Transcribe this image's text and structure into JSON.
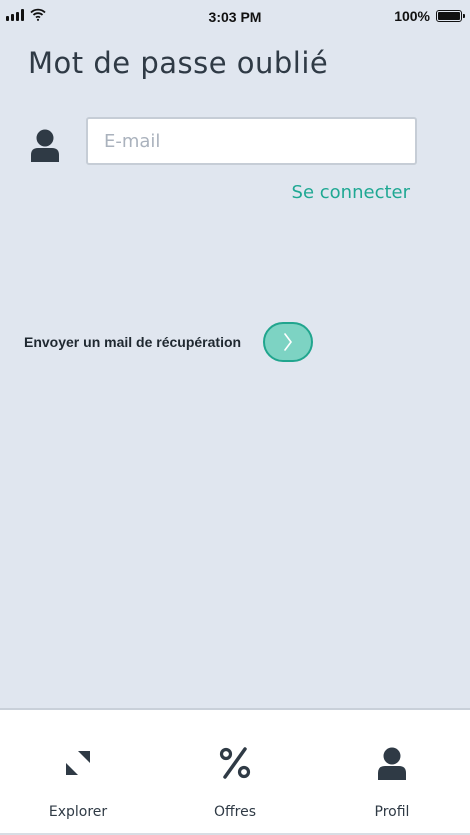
{
  "status_bar": {
    "time": "3:03 PM",
    "battery": "100%"
  },
  "page": {
    "title": "Mot de passe oublié"
  },
  "form": {
    "email_placeholder": "E-mail",
    "email_value": "",
    "signin_link": "Se connecter",
    "send_label": "Envoyer un mail de récupération"
  },
  "tabs": [
    {
      "label": "Explorer",
      "icon": "explore-arrows-icon"
    },
    {
      "label": "Offres",
      "icon": "percent-icon"
    },
    {
      "label": "Profil",
      "icon": "user-icon"
    }
  ],
  "colors": {
    "accent": "#1fa893",
    "button_fill": "#7dd3c3",
    "background": "#e0e6ef",
    "text": "#2f3a45"
  }
}
